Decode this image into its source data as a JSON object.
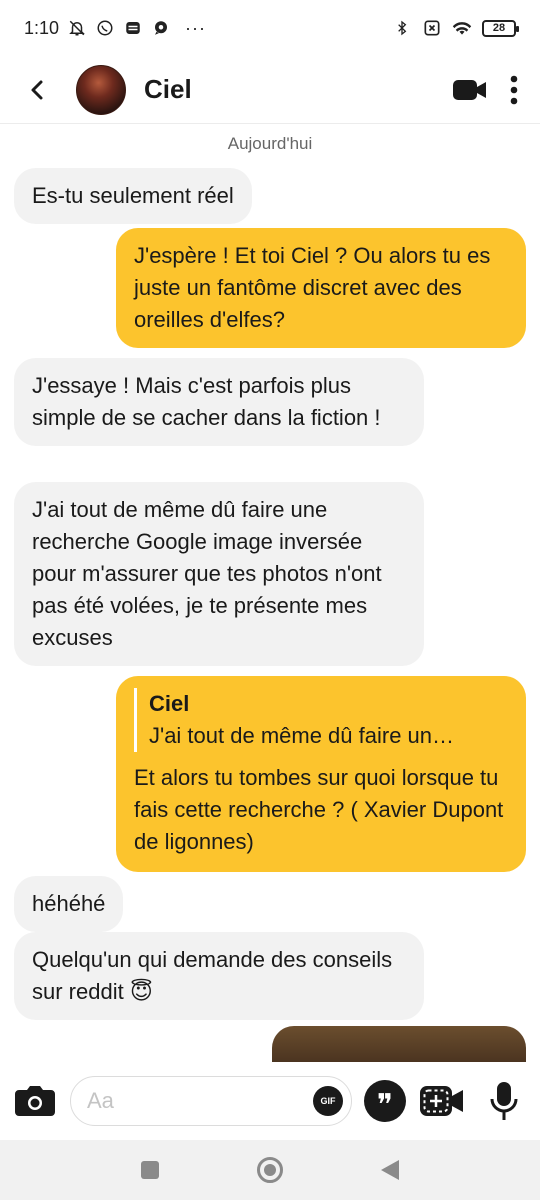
{
  "status_bar": {
    "time": "1:10",
    "ellipsis": "···",
    "battery": "28",
    "icons": [
      "bell-off-icon",
      "whatsapp-icon",
      "app-icon",
      "chat-icon",
      "bluetooth-icon",
      "sim-off-icon",
      "wifi-icon",
      "battery-icon"
    ]
  },
  "header": {
    "contact_name": "Ciel",
    "icons": [
      "back-arrow-icon",
      "video-call-icon",
      "more-vertical-icon"
    ]
  },
  "chat": {
    "date_separator": "Aujourd'hui",
    "messages": [
      {
        "from": "them",
        "text": "Es-tu seulement réel"
      },
      {
        "from": "me",
        "text": "J'espère ! Et toi Ciel ? Ou alors tu es juste un fantôme discret avec des oreilles d'elfes?"
      },
      {
        "from": "them",
        "text": "J'essaye ! Mais c'est parfois plus simple de se cacher dans la fiction !"
      },
      {
        "from": "them",
        "text": "J'ai tout de même dû faire une recherche Google image inversée pour m'assurer que tes photos n'ont pas été volées, je te présente mes excuses"
      },
      {
        "from": "me",
        "quote_author": "Ciel",
        "quote_text": "J'ai tout de même dû faire un…",
        "text": "Et alors tu tombes sur quoi lorsque tu fais cette recherche ? ( Xavier Dupont de ligonnes)"
      },
      {
        "from": "them",
        "text": "héhéhé"
      },
      {
        "from": "them",
        "text": "Quelqu'un qui demande des conseils sur reddit 😇"
      }
    ]
  },
  "composer": {
    "placeholder": "Aa",
    "gif_label": "GIF",
    "quote_glyph": "❞",
    "icons": [
      "camera-icon",
      "gif-icon",
      "quote-icon",
      "video-add-icon",
      "microphone-icon"
    ]
  },
  "colors": {
    "outgoing_bubble": "#fcc42d",
    "incoming_bubble": "#f2f2f2"
  }
}
